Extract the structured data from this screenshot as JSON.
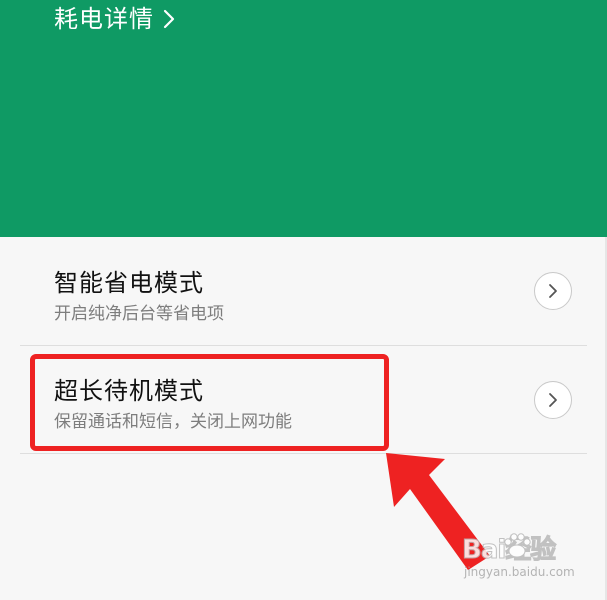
{
  "header": {
    "link_label": "耗电详情",
    "background_color": "#0f9a64"
  },
  "settings": [
    {
      "title": "智能省电模式",
      "subtitle": "开启纯净后台等省电项"
    },
    {
      "title": "超长待机模式",
      "subtitle": "保留通话和短信，关闭上网功能"
    }
  ],
  "annotation": {
    "highlight_color": "#ee2222"
  },
  "watermark": {
    "logo_text": "Bai经验",
    "domain": "jingyan.baidu.com"
  },
  "icons": {
    "header_chevron": "chevron-right-icon",
    "item_chevron": "chevron-right-circle-icon",
    "watermark_paw": "paw-icon"
  }
}
